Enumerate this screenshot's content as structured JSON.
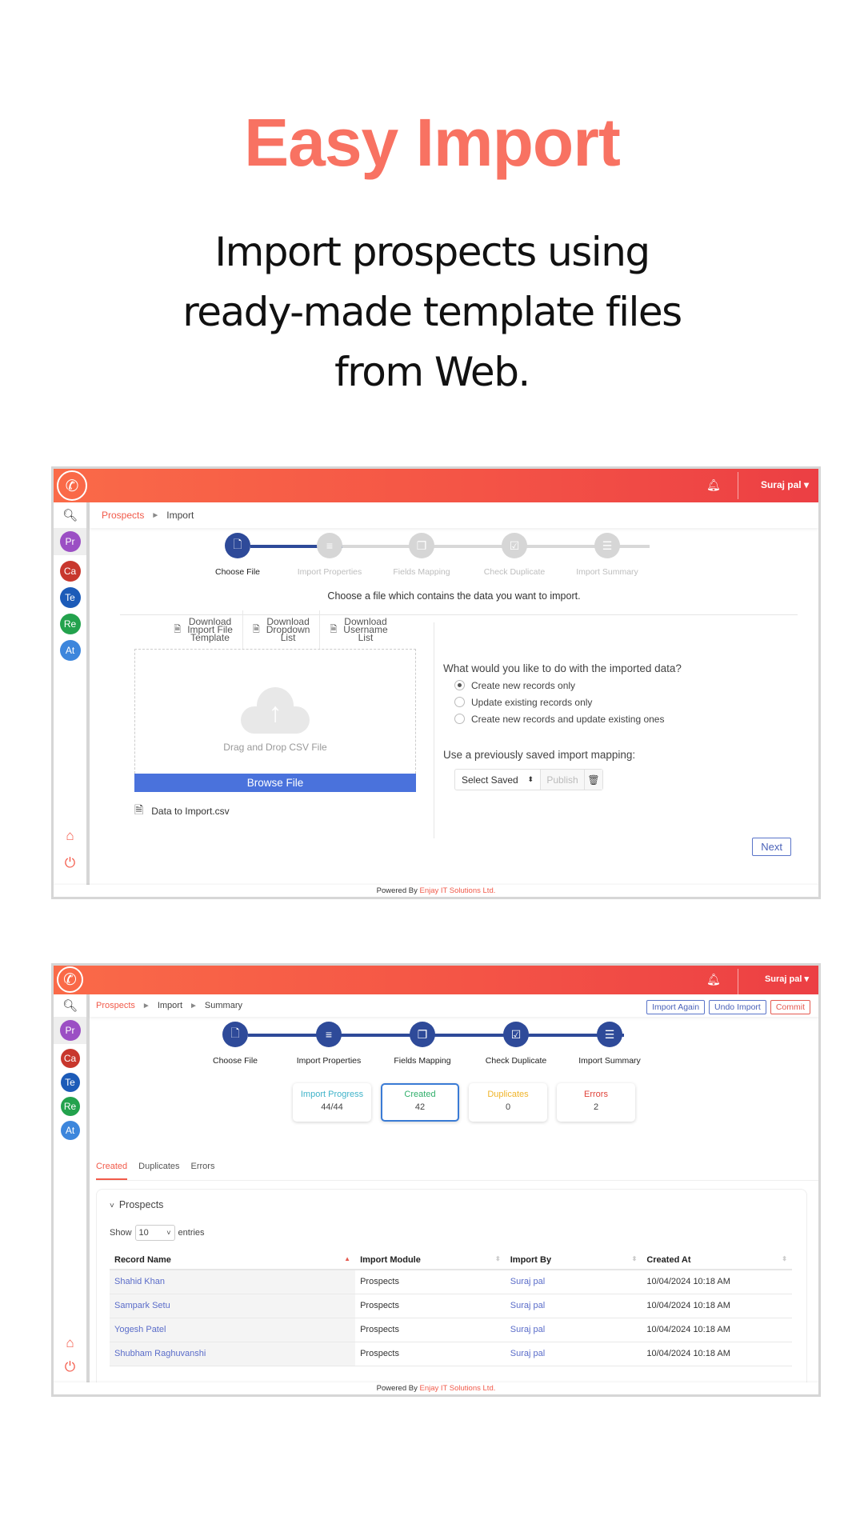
{
  "hero": {
    "title": "Easy Import",
    "subtitle": "Import prospects using ready-made template files from Web."
  },
  "colors": {
    "accent": "#f87262",
    "header_gradient_start": "#fa6a48",
    "header_gradient_end": "#ec3f44",
    "stepper_active": "#2e4a99",
    "browse_button": "#4a72dc"
  },
  "app": {
    "user_name": "Suraj pal",
    "user_caret": "▾",
    "logo_icon": "phone-chart-icon",
    "bell_icon": "bell-icon",
    "sidebar": {
      "search_icon": "search-icon",
      "items": [
        {
          "label": "Pr",
          "color": "#9b4fc4"
        },
        {
          "label": "Ca",
          "color": "#c8372d"
        },
        {
          "label": "Te",
          "color": "#1c5bb8"
        },
        {
          "label": "Re",
          "color": "#23a24d"
        },
        {
          "label": "At",
          "color": "#3c86dc"
        }
      ],
      "home_icon": "home-icon",
      "power_icon": "power-icon"
    },
    "footer": {
      "prefix": "Powered By",
      "brand": "Enjay IT Solutions Ltd."
    }
  },
  "screen1": {
    "breadcrumb": [
      "Prospects",
      "Import"
    ],
    "steps": [
      {
        "label": "Choose File",
        "state": "active",
        "icon": "file-icon"
      },
      {
        "label": "Import Properties",
        "state": "pending",
        "icon": "file-text-icon"
      },
      {
        "label": "Fields Mapping",
        "state": "pending",
        "icon": "files-icon"
      },
      {
        "label": "Check Duplicate",
        "state": "pending",
        "icon": "check-square-icon"
      },
      {
        "label": "Import Summary",
        "state": "pending",
        "icon": "list-icon"
      }
    ],
    "description": "Choose a file which contains the data you want to import.",
    "downloads": [
      {
        "line1": "Download",
        "line2": "Import File",
        "line3": "Template"
      },
      {
        "line1": "Download",
        "line2": "Dropdown",
        "line3": "List"
      },
      {
        "line1": "Download",
        "line2": "Username",
        "line3": "List"
      }
    ],
    "drop_text": "Drag and Drop CSV File",
    "browse_label": "Browse File",
    "selected_file": "Data to Import.csv",
    "question": "What would you like to do with the imported data?",
    "options": [
      {
        "label": "Create new records only",
        "checked": true
      },
      {
        "label": "Update existing records only",
        "checked": false
      },
      {
        "label": "Create new records and update existing ones",
        "checked": false
      }
    ],
    "mapping_label": "Use a previously saved import mapping:",
    "mapping_select": "Select Saved",
    "publish_label": "Publish",
    "next_label": "Next"
  },
  "screen2": {
    "breadcrumb": [
      "Prospects",
      "Import",
      "Summary"
    ],
    "actions": {
      "import_again": "Import Again",
      "undo_import": "Undo Import",
      "commit": "Commit"
    },
    "steps": [
      {
        "label": "Choose File",
        "state": "done"
      },
      {
        "label": "Import Properties",
        "state": "done"
      },
      {
        "label": "Fields Mapping",
        "state": "done"
      },
      {
        "label": "Check Duplicate",
        "state": "done"
      },
      {
        "label": "Import Summary",
        "state": "done"
      }
    ],
    "cards": [
      {
        "title": "Import Progress",
        "value": "44/44",
        "color": "#3fb3c9"
      },
      {
        "title": "Created",
        "value": "42",
        "color": "#2fae6a"
      },
      {
        "title": "Duplicates",
        "value": "0",
        "color": "#f0b429"
      },
      {
        "title": "Errors",
        "value": "2",
        "color": "#e0433a"
      }
    ],
    "tabs": [
      "Created",
      "Duplicates",
      "Errors"
    ],
    "active_tab": "Created",
    "panel_title": "Prospects",
    "show_label": "Show",
    "entries_value": "10",
    "entries_label": "entries",
    "table": {
      "columns": [
        "Record Name",
        "Import Module",
        "Import By",
        "Created At"
      ],
      "sorted_column": "Record Name",
      "rows": [
        [
          "Shahid Khan",
          "Prospects",
          "Suraj pal",
          "10/04/2024 10:18 AM"
        ],
        [
          "Sampark Setu",
          "Prospects",
          "Suraj pal",
          "10/04/2024 10:18 AM"
        ],
        [
          "Yogesh Patel",
          "Prospects",
          "Suraj pal",
          "10/04/2024 10:18 AM"
        ],
        [
          "Shubham Raghuvanshi",
          "Prospects",
          "Suraj pal",
          "10/04/2024 10:18 AM"
        ]
      ]
    }
  }
}
